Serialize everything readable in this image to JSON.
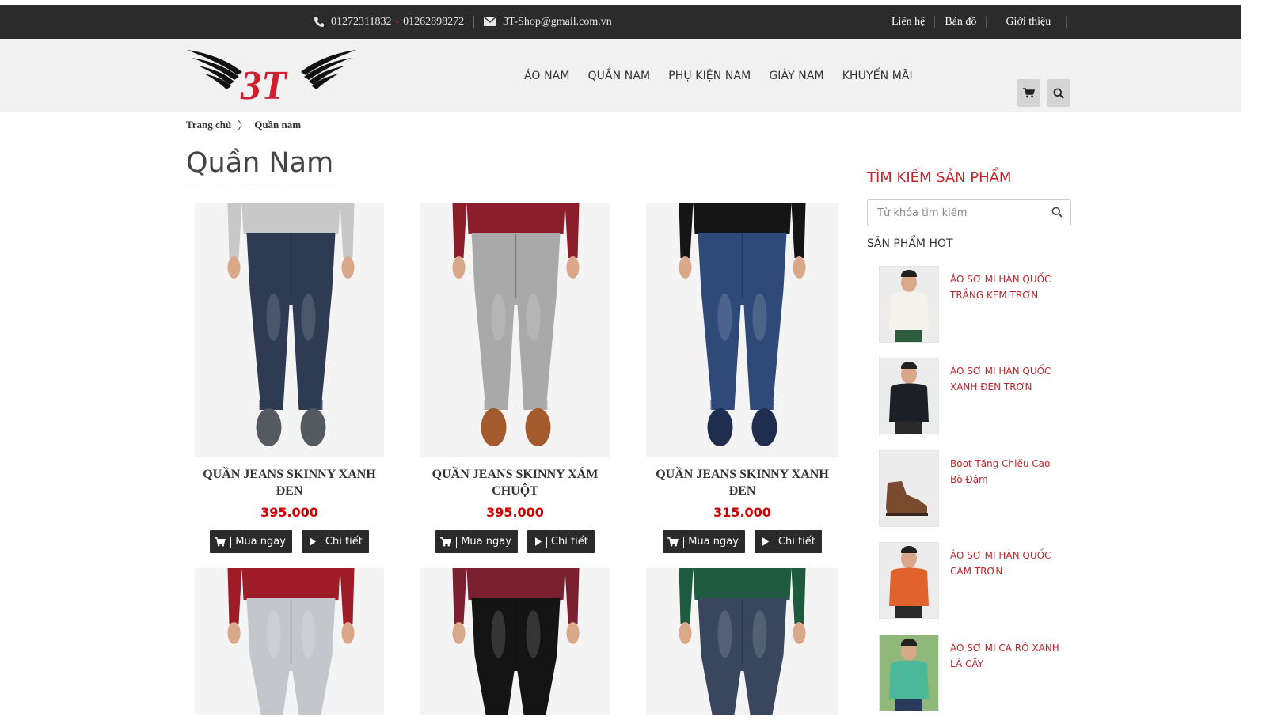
{
  "topbar": {
    "phone1": "01272311832",
    "phone_sep": "-",
    "phone2": "01262898272",
    "email": "3T-Shop@gmail.com.vn",
    "links": [
      "Liên hệ",
      "Bản đồ",
      "Giới thiệu"
    ]
  },
  "header": {
    "logo_text": "3T",
    "nav": [
      "ÁO NAM",
      "QUẦN NAM",
      "PHỤ KIỆN NAM",
      "GIÀY NAM",
      "KHUYẾN MÃI"
    ],
    "cart_icon": "cart-icon",
    "search_icon": "search-icon"
  },
  "breadcrumb": {
    "home": "Trang chủ",
    "current": "Quần nam"
  },
  "page_title": "Quần Nam",
  "products": [
    {
      "name": "QUẦN JEANS SKINNY XANH ĐEN",
      "price": "395.000",
      "buy_label": "Mua ngay",
      "detail_label": "Chi tiết",
      "jeans_color": "#2e3b52",
      "top_color": "#c8c8c8",
      "shoe_color": "#555a60"
    },
    {
      "name": "QUẦN JEANS SKINNY XÁM CHUỘT",
      "price": "395.000",
      "buy_label": "Mua ngay",
      "detail_label": "Chi tiết",
      "jeans_color": "#a9a9a9",
      "top_color": "#8c1d2a",
      "shoe_color": "#a35a2c"
    },
    {
      "name": "QUẦN JEANS SKINNY XANH ĐEN",
      "price": "315.000",
      "buy_label": "Mua ngay",
      "detail_label": "Chi tiết",
      "jeans_color": "#2f4a78",
      "top_color": "#151515",
      "shoe_color": "#1f2d4e"
    }
  ],
  "products_row2": [
    {
      "jeans_color": "#c3c7cc",
      "top_color": "#9e1b28"
    },
    {
      "jeans_color": "#141414",
      "top_color": "#7a2030"
    },
    {
      "jeans_color": "#3a465e",
      "top_color": "#1e5a40"
    }
  ],
  "sidebar": {
    "search_title": "TÌM KIẾM SẢN PHẨM",
    "search_placeholder": "Từ khóa tìm kiếm",
    "hot_title": "SẢN PHẨM HOT",
    "hot_items": [
      {
        "name": "ÁO SƠ MI HÀN QUỐC TRẮNG KEM TRƠN",
        "color": "#f4f2ec",
        "pants": "#2e5e3e"
      },
      {
        "name": "ÁO SƠ MI HÀN QUỐC XANH ĐEN TRƠN",
        "color": "#1c1f26",
        "pants": "#2a2a2a"
      },
      {
        "name": "Boot Tăng Chiều Cao Bò Đậm",
        "color": "#7a4a2e",
        "pants": ""
      },
      {
        "name": "ÁO SƠ MI HÀN QUỐC CAM TRƠN",
        "color": "#e2622e",
        "pants": "#2a2a2a"
      },
      {
        "name": "ÁO SƠ MI CA RÔ XANH LÁ CÂY",
        "color": "#4bb89a",
        "pants": "#2a3a5a"
      }
    ]
  },
  "colors": {
    "accent_red": "#c0272d",
    "price_red": "#cc0000",
    "topbar_bg": "#2b2b2b",
    "header_bg": "#f1f1f1"
  }
}
